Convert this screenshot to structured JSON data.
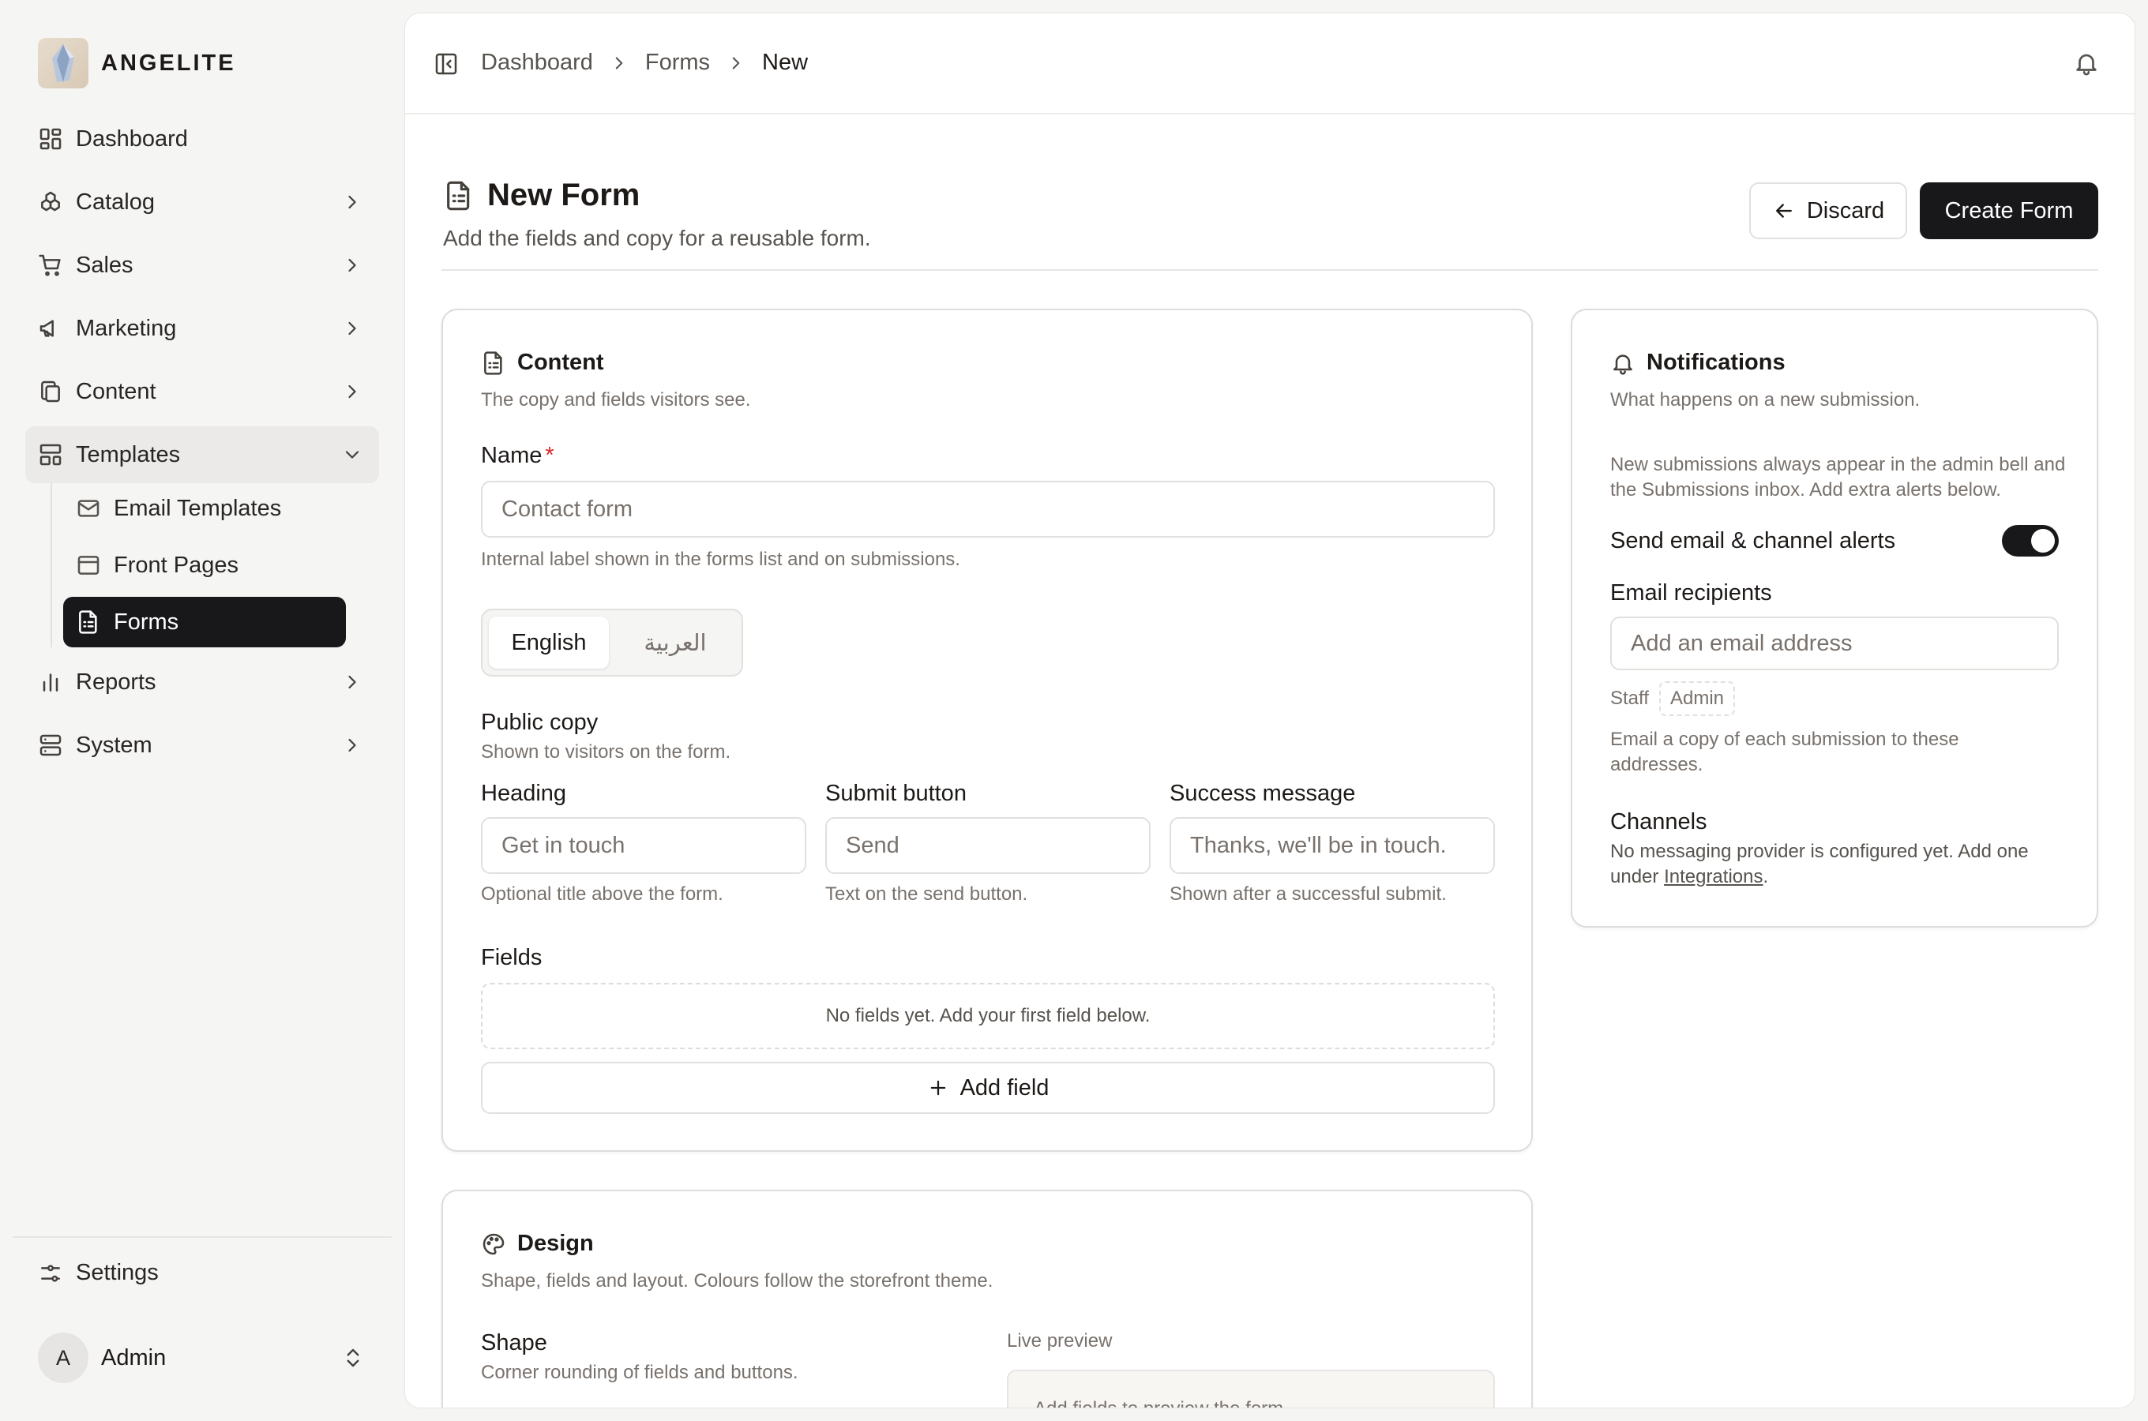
{
  "brand": {
    "name": "ANGELITE"
  },
  "sidebar": {
    "items": [
      {
        "label": "Dashboard"
      },
      {
        "label": "Catalog"
      },
      {
        "label": "Sales"
      },
      {
        "label": "Marketing"
      },
      {
        "label": "Content"
      },
      {
        "label": "Templates"
      },
      {
        "label": "Reports"
      },
      {
        "label": "System"
      }
    ],
    "templates_sub": [
      {
        "label": "Email Templates"
      },
      {
        "label": "Front Pages"
      },
      {
        "label": "Forms"
      }
    ],
    "settings": "Settings",
    "user": {
      "initial": "A",
      "name": "Admin"
    }
  },
  "breadcrumb": [
    "Dashboard",
    "Forms",
    "New"
  ],
  "page": {
    "title": "New Form",
    "subtitle": "Add the fields and copy for a reusable form.",
    "discard_label": "Discard",
    "create_label": "Create Form"
  },
  "content_card": {
    "title": "Content",
    "subtitle": "The copy and fields visitors see.",
    "name_label": "Name",
    "required_mark": "*",
    "name_placeholder": "Contact form",
    "name_help": "Internal label shown in the forms list and on submissions.",
    "languages": [
      "English",
      "العربية"
    ],
    "public_copy_title": "Public copy",
    "public_copy_sub": "Shown to visitors on the form.",
    "heading_label": "Heading",
    "heading_placeholder": "Get in touch",
    "heading_help": "Optional title above the form.",
    "submit_label": "Submit button",
    "submit_placeholder": "Send",
    "submit_help": "Text on the send button.",
    "success_label": "Success message",
    "success_placeholder": "Thanks, we'll be in touch.",
    "success_help": "Shown after a successful submit.",
    "fields_label": "Fields",
    "fields_empty": "No fields yet. Add your first field below.",
    "add_field_label": "Add field"
  },
  "design_card": {
    "title": "Design",
    "subtitle": "Shape, fields and layout. Colours follow the storefront theme.",
    "shape_label": "Shape",
    "shape_sub": "Corner rounding of fields and buttons.",
    "preview_label": "Live preview",
    "preview_text": "Add fields to preview the form."
  },
  "notifications_card": {
    "title": "Notifications",
    "subtitle": "What happens on a new submission.",
    "info": "New submissions always appear in the admin bell and the Submissions inbox. Add extra alerts below.",
    "toggle_label": "Send email & channel alerts",
    "toggle_on": true,
    "recipients_label": "Email recipients",
    "recipients_placeholder": "Add an email address",
    "staff_label": "Staff",
    "staff_chip": "Admin",
    "recipients_help": "Email a copy of each submission to these addresses.",
    "channels_label": "Channels",
    "channels_text": "No messaging provider is configured yet. Add one under",
    "channels_link": "Integrations",
    "channels_end": "."
  },
  "colors": {
    "accent": "#18181b",
    "required": "#dc2626",
    "background": "#f5f5f4"
  }
}
